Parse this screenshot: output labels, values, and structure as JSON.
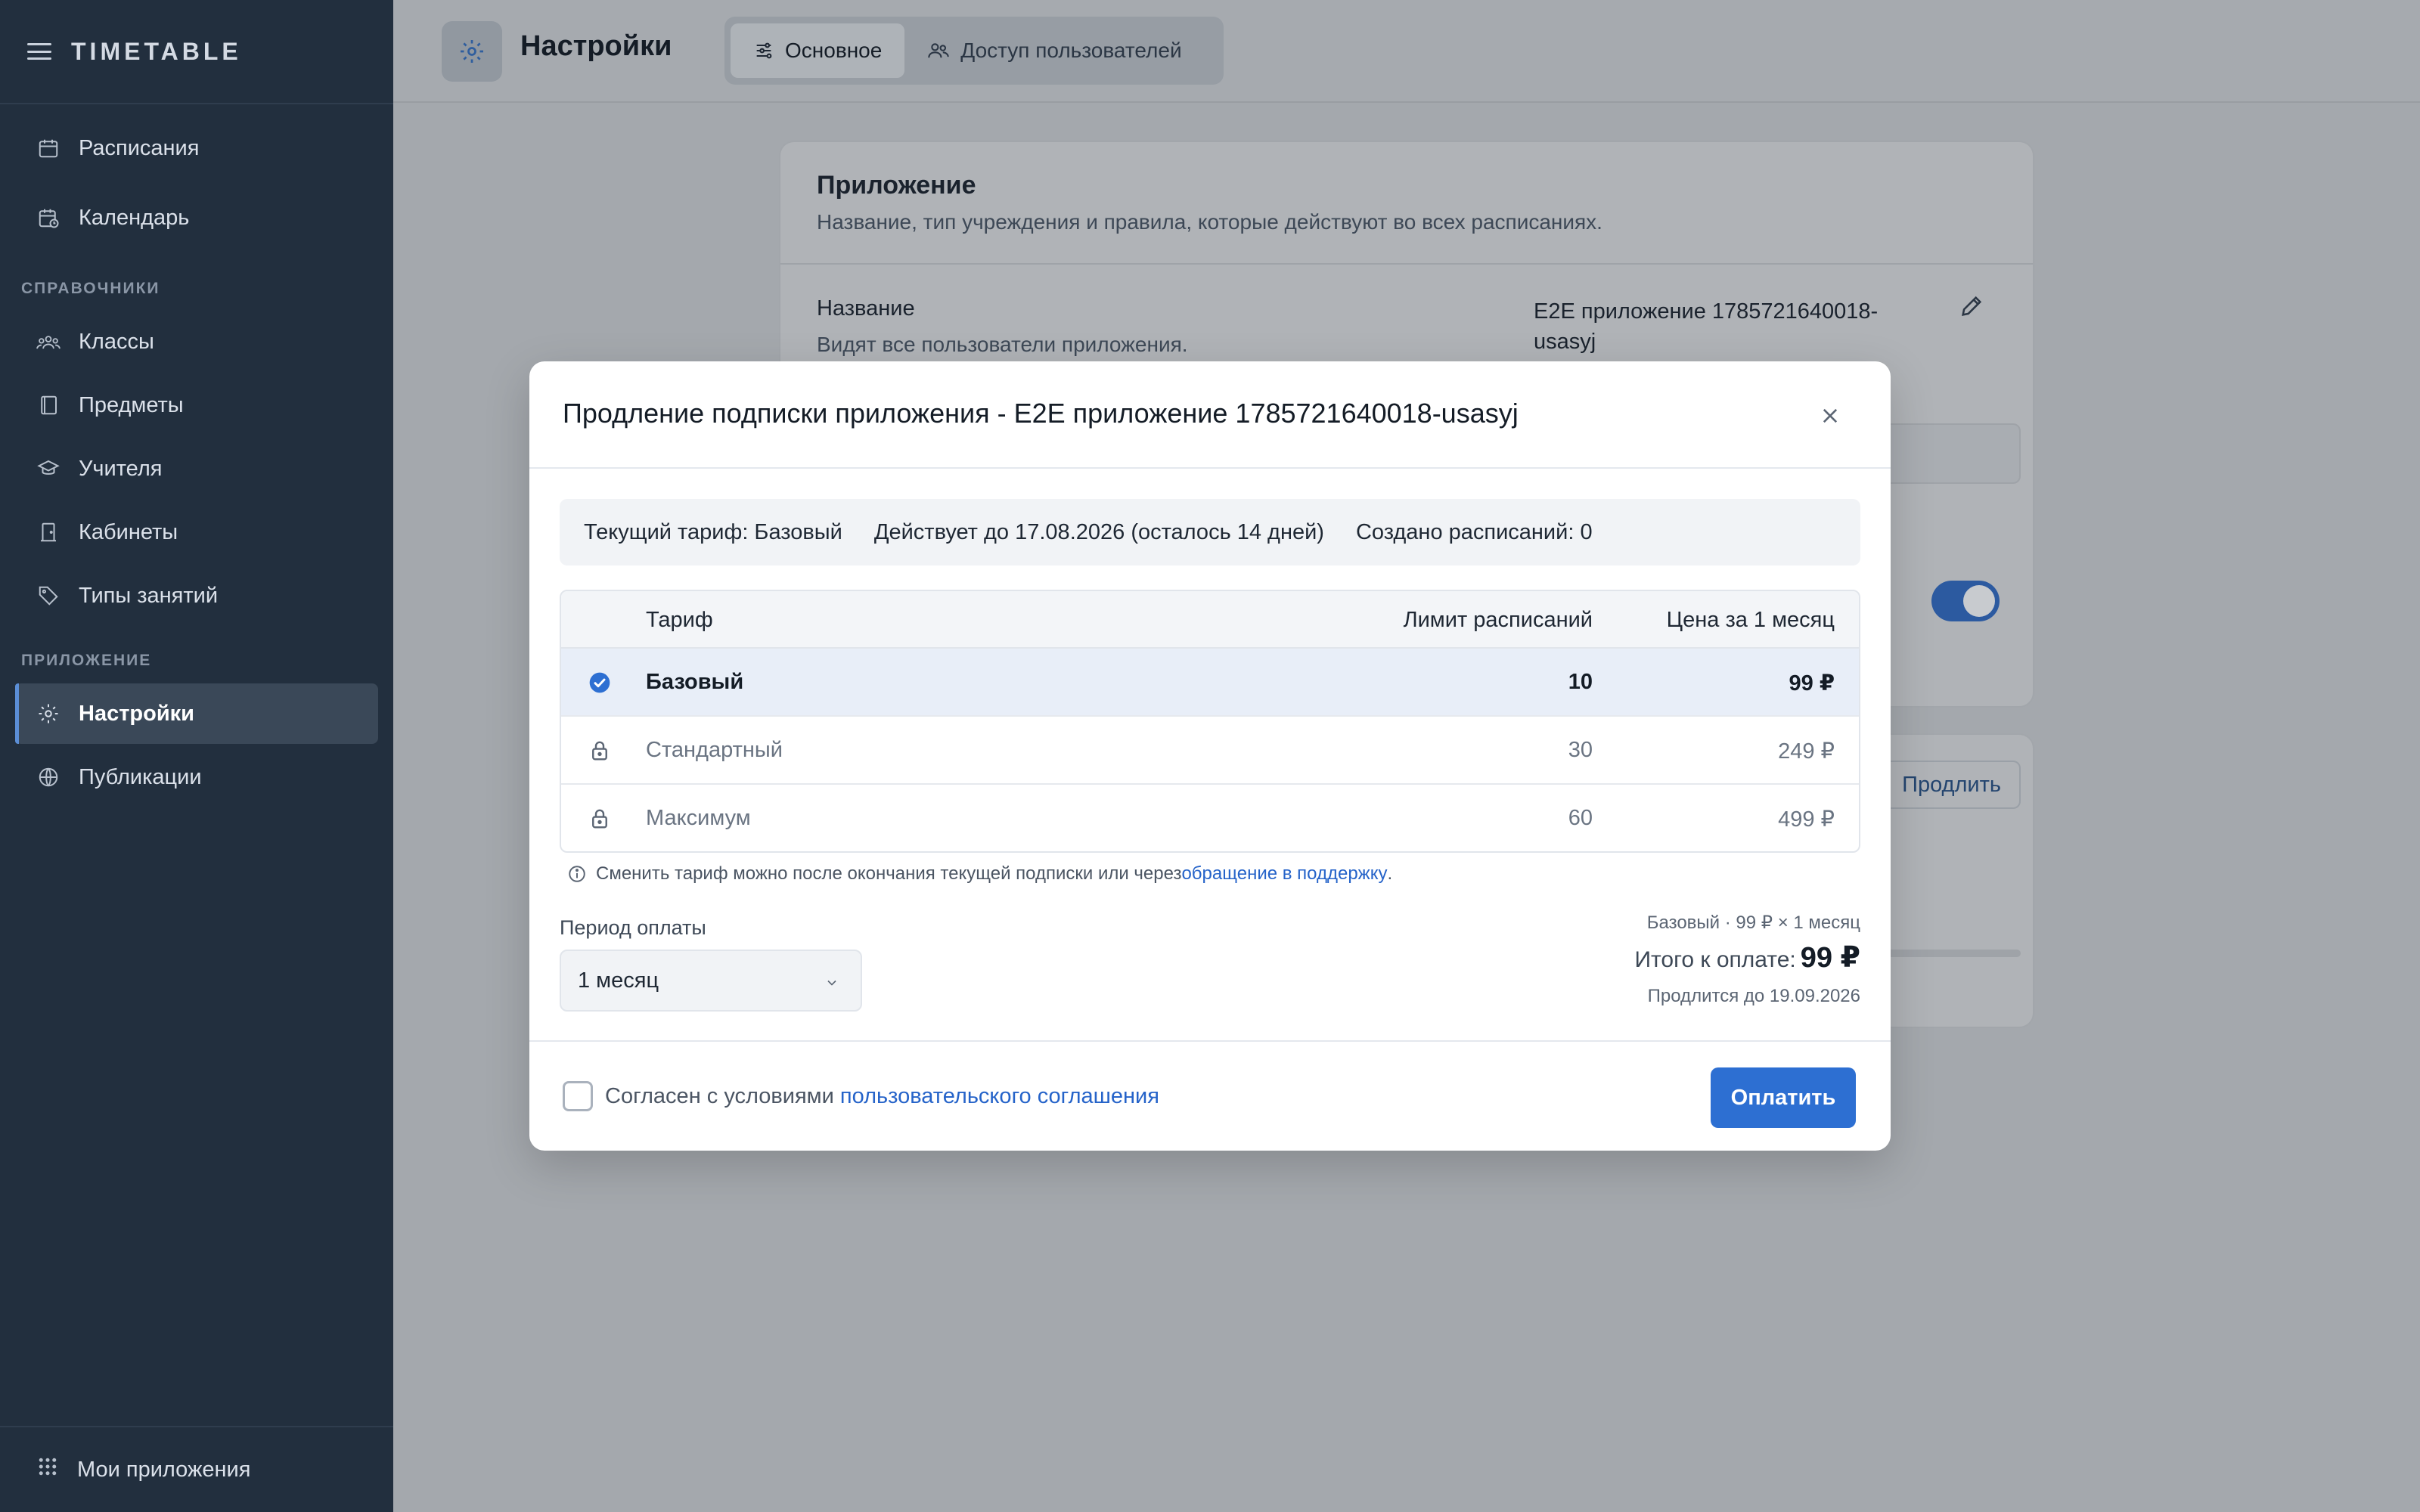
{
  "sidebar": {
    "brand": "TIMETABLE",
    "items_top": [
      {
        "label": "Расписания",
        "icon": "calendar-icon"
      },
      {
        "label": "Календарь",
        "icon": "calendar-clock-icon"
      }
    ],
    "section_ref": "СПРАВОЧНИКИ",
    "items_ref": [
      {
        "label": "Классы",
        "icon": "group-icon"
      },
      {
        "label": "Предметы",
        "icon": "book-icon"
      },
      {
        "label": "Учителя",
        "icon": "graduation-cap-icon"
      },
      {
        "label": "Кабинеты",
        "icon": "door-icon"
      },
      {
        "label": "Типы занятий",
        "icon": "tag-icon"
      }
    ],
    "section_app": "ПРИЛОЖЕНИЕ",
    "items_app": [
      {
        "label": "Настройки",
        "icon": "gear-icon",
        "active": true
      },
      {
        "label": "Публикации",
        "icon": "globe-icon"
      }
    ],
    "bottom": {
      "label": "Мои приложения",
      "icon": "grid-icon"
    }
  },
  "header": {
    "title": "Настройки",
    "tabs": [
      {
        "label": "Основное",
        "active": true
      },
      {
        "label": "Доступ пользователей",
        "active": false
      }
    ]
  },
  "background": {
    "card_title": "Приложение",
    "card_subtitle": "Название, тип учреждения и правила, которые действуют во всех расписаниях.",
    "name_label": "Название",
    "name_desc": "Видят все пользователи приложения.",
    "name_value": "E2E приложение 1785721640018-usasyj",
    "renew_button": "Продлить"
  },
  "modal": {
    "title": "Продление подписки приложения - E2E приложение 1785721640018-usasyj",
    "info": {
      "current_plan": "Текущий тариф: Базовый",
      "valid_until": "Действует до 17.08.2026 (осталось 14 дней)",
      "schedules_created": "Создано расписаний: 0"
    },
    "table": {
      "headers": {
        "plan": "Тариф",
        "limit": "Лимит расписаний",
        "price": "Цена за 1 месяц"
      },
      "rows": [
        {
          "name": "Базовый",
          "limit": "10",
          "price": "99 ₽",
          "selected": true
        },
        {
          "name": "Стандартный",
          "limit": "30",
          "price": "249 ₽",
          "locked": true
        },
        {
          "name": "Максимум",
          "limit": "60",
          "price": "499 ₽",
          "locked": true
        }
      ]
    },
    "note_text": "Сменить тариф можно после окончания текущей подписки или через ",
    "note_link": "обращение в поддержку",
    "note_end": ".",
    "period_label": "Период оплаты",
    "period_value": "1 месяц",
    "summary_line": "Базовый · 99 ₽ × 1 месяц",
    "total_label": "Итого к оплате:",
    "total_value": "99 ₽",
    "renew_until": "Продлится до 19.09.2026",
    "agree_text": "Согласен с условиями ",
    "agree_link": "пользовательского соглашения",
    "agree_checked": false,
    "pay_button": "Оплатить"
  },
  "colors": {
    "sidebar_bg": "#222f3e",
    "accent": "#2d6fd2",
    "link": "#2563c9",
    "selected_row": "#e8eef8"
  }
}
